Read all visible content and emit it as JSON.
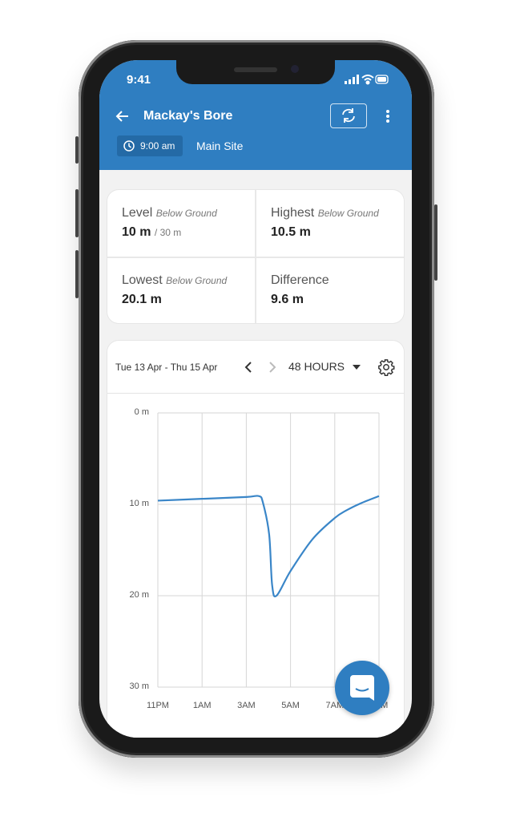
{
  "status_bar": {
    "time": "9:41"
  },
  "header": {
    "title": "Mackay's Bore",
    "time_badge": "9:00 am",
    "site": "Main Site",
    "back_icon": "arrow-left-icon",
    "refresh_icon": "refresh-icon",
    "menu_icon": "more-vertical-icon"
  },
  "stats": [
    {
      "label": "Level",
      "qualifier": "Below Ground",
      "value": "10 m",
      "suffix": "/ 30 m"
    },
    {
      "label": "Highest",
      "qualifier": "Below Ground",
      "value": "10.5 m"
    },
    {
      "label": "Lowest",
      "qualifier": "Below Ground",
      "value": "20.1 m"
    },
    {
      "label": "Difference",
      "value": "9.6 m"
    }
  ],
  "chart_controls": {
    "date_range": "Tue 13 Apr - Thu 15 Apr",
    "period": "48 HOURS"
  },
  "colors": {
    "brand": "#2f7ec1",
    "line": "#3a86c8"
  },
  "chart_data": {
    "type": "line",
    "y_ticks": [
      "0 m",
      "10 m",
      "20 m",
      "30 m"
    ],
    "ylim": [
      0,
      30
    ],
    "y_inverted": true,
    "x_ticks": [
      "11PM",
      "1AM",
      "3AM",
      "5AM",
      "7AM",
      "9AM"
    ],
    "xlim": [
      "23:00",
      "09:00"
    ],
    "grid": true,
    "series": [
      {
        "points": [
          [
            "23:00",
            9.6
          ],
          [
            "01:00",
            9.4
          ],
          [
            "03:00",
            9.2
          ],
          [
            "03:34",
            9.1
          ],
          [
            "03:45",
            9.8
          ],
          [
            "04:02",
            13.3
          ],
          [
            "04:10",
            18.8
          ],
          [
            "04:22",
            20.0
          ],
          [
            "05:00",
            17.3
          ],
          [
            "06:00",
            13.8
          ],
          [
            "07:00",
            11.5
          ],
          [
            "07:30",
            10.7
          ],
          [
            "08:10",
            9.9
          ],
          [
            "09:00",
            9.1
          ]
        ]
      }
    ]
  }
}
